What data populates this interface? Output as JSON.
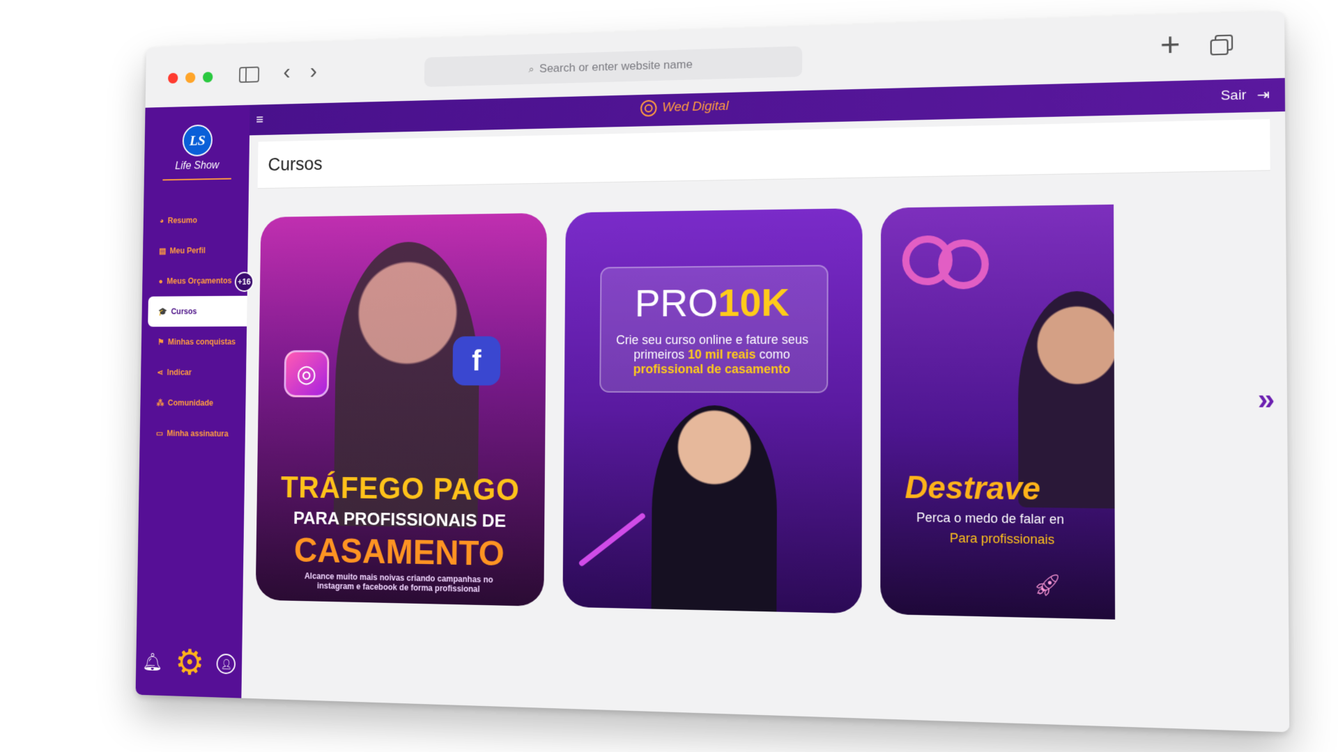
{
  "browser": {
    "search_placeholder": "Search or enter website name"
  },
  "topbar": {
    "brand": "Wed Digital",
    "logout_label": "Sair"
  },
  "sidebar": {
    "logo_initials": "LS",
    "logo_name": "Life Show",
    "items": [
      {
        "label": "Resumo"
      },
      {
        "label": "Meu Perfil"
      },
      {
        "label": "Meus Orçamentos",
        "badge": "+16"
      },
      {
        "label": "Cursos"
      },
      {
        "label": "Minhas conquistas"
      },
      {
        "label": "Indicar"
      },
      {
        "label": "Comunidade"
      },
      {
        "label": "Minha assinatura"
      }
    ]
  },
  "main": {
    "page_title": "Cursos",
    "courses": [
      {
        "line1": "TRÁFEGO PAGO",
        "line2": "PARA PROFISSIONAIS DE",
        "line3": "CASAMENTO",
        "description": "Alcance muito mais noivas criando campanhas no instagram e facebook de forma profissional"
      },
      {
        "title_a": "PRO",
        "title_b": "10K",
        "sub1": "Crie seu curso online e fature seus primeiros",
        "sub_highlight1": "10 mil reais",
        "sub2": "como",
        "sub_highlight2": "profissional de casamento"
      },
      {
        "title": "Destrave",
        "sub1": "Perca o medo de falar en",
        "sub2": "Para profissionais"
      }
    ]
  },
  "colors": {
    "sidebar": "#560f96",
    "accent": "#ff9c3f",
    "highlight": "#ffcb1a"
  }
}
